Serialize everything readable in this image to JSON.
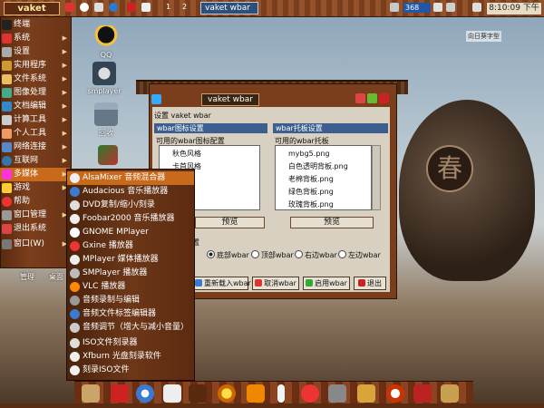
{
  "top_panel": {
    "start_label": "vaket",
    "workspaces": [
      "1",
      "2"
    ],
    "task_label": "vaket wbar",
    "cpu_label": "368",
    "clock": "8:10:09 下午"
  },
  "desktop": {
    "icons": [
      {
        "label": "QQ",
        "icon": "qq-penguin-icon"
      },
      {
        "label": "smplayer",
        "icon": "smplayer-icon"
      },
      {
        "label": "回收",
        "icon": "trash-icon"
      }
    ],
    "watermark": "向日葵字型",
    "partial_labels": [
      "管理",
      "桌面"
    ]
  },
  "main_menu": {
    "items": [
      {
        "label": "终端",
        "icon": "terminal-icon",
        "submenu": false
      },
      {
        "label": "系统",
        "icon": "system-icon",
        "submenu": true
      },
      {
        "label": "设置",
        "icon": "settings-icon",
        "submenu": true
      },
      {
        "label": "实用程序",
        "icon": "utilities-icon",
        "submenu": true
      },
      {
        "label": "文件系统",
        "icon": "filesystem-icon",
        "submenu": true
      },
      {
        "label": "图像处理",
        "icon": "graphics-icon",
        "submenu": true
      },
      {
        "label": "文档编辑",
        "icon": "document-icon",
        "submenu": true
      },
      {
        "label": "计算工具",
        "icon": "calculator-icon",
        "submenu": true
      },
      {
        "label": "个人工具",
        "icon": "personal-icon",
        "submenu": true
      },
      {
        "label": "网络连接",
        "icon": "network-icon",
        "submenu": true
      },
      {
        "label": "互联网",
        "icon": "internet-icon",
        "submenu": true
      },
      {
        "label": "多媒体",
        "icon": "multimedia-icon",
        "submenu": true
      },
      {
        "label": "游戏",
        "icon": "games-icon",
        "submenu": true
      },
      {
        "label": "帮助",
        "icon": "help-icon",
        "submenu": false
      },
      {
        "label": "窗口管理",
        "icon": "window-manager-icon",
        "submenu": true
      },
      {
        "label": "退出系统",
        "icon": "logout-icon",
        "submenu": false
      },
      {
        "label": "窗口(W)",
        "icon": "window-icon",
        "submenu": true
      }
    ],
    "highlighted": "多媒体"
  },
  "multimedia_menu": {
    "items": [
      "AlsaMixer 音频混合器",
      "Audacious 音乐播放器",
      "DVD复制/缩小/刻录",
      "Foobar2000 音乐播放器",
      "GNOME MPlayer",
      "Gxine 播放器",
      "MPlayer 媒体播放器",
      "SMPlayer 播放器",
      "VLC 播放器",
      "音频录制与编辑",
      "音频文件标签编辑器",
      "音频调节（增大与减小音量）",
      "ISO文件刻录器",
      "Xfburn 光盘刻录软件",
      "刻录ISO文件"
    ],
    "highlighted": "AlsaMixer 音频混合器"
  },
  "wbar_window": {
    "title": "vaket wbar",
    "left_panel_header": "设置 vaket wbar",
    "left_sub_header": "wbar图标设置",
    "left_list_title": "可用的wbar图标配置",
    "left_items": [
      "秋色风格",
      "卡首风格",
      "风格",
      "格"
    ],
    "left_button": "预览",
    "right_panel_header": "wbar托板设置",
    "right_list_title": "可用的wbar托板",
    "right_items": [
      "mybg5.png",
      "白色透明背板.png",
      "老棉背板.png",
      "绿色背板.png",
      "玫瑰背板.png"
    ],
    "right_button": "预览",
    "position_label": "置",
    "positions": [
      "底部wbar",
      "顶部wbar",
      "右边wbar",
      "左边wbar"
    ],
    "selected_position": "底部wbar",
    "actions": [
      "重新载入wbar",
      "取消wbar",
      "启用wbar",
      "退出"
    ]
  },
  "colors": {
    "panel_brown": "#7a3e1c",
    "menu_highlight": "#c86a1c",
    "window_face": "#d8d0c0",
    "title_blue": "#3d5f8f"
  }
}
